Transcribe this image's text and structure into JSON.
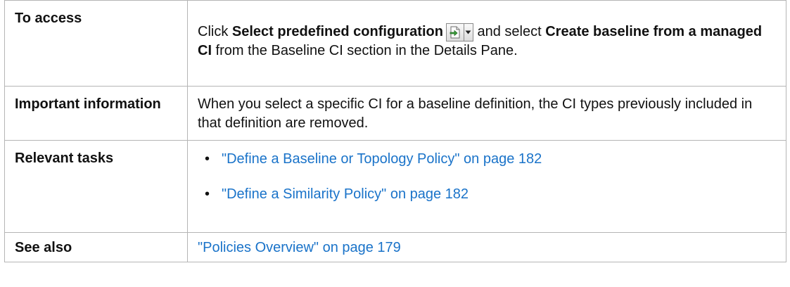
{
  "rows": {
    "access": {
      "label": "To access",
      "pre": "Click ",
      "bold1": "Select predefined configuration",
      "mid": " and select ",
      "bold2": "Create baseline from a managed CI",
      "post": " from the Baseline CI section in the Details Pane."
    },
    "important": {
      "label": "Important information",
      "text": "When you select a specific CI for a baseline definition, the CI types previously included in that definition are removed."
    },
    "tasks": {
      "label": "Relevant tasks",
      "items": [
        "\"Define a Baseline or Topology Policy\" on page 182",
        "\"Define a Similarity Policy\" on page 182"
      ]
    },
    "see_also": {
      "label": "See also",
      "link": "\"Policies Overview\" on page 179"
    }
  },
  "icons": {
    "toolbar_button": "select-predefined-configuration-icon",
    "dropdown": "dropdown-arrow-icon",
    "bullet": "•"
  },
  "colors": {
    "link": "#1a73c9",
    "border": "#b5b5b5",
    "text": "#111111",
    "icon_green": "#3aa03a"
  }
}
